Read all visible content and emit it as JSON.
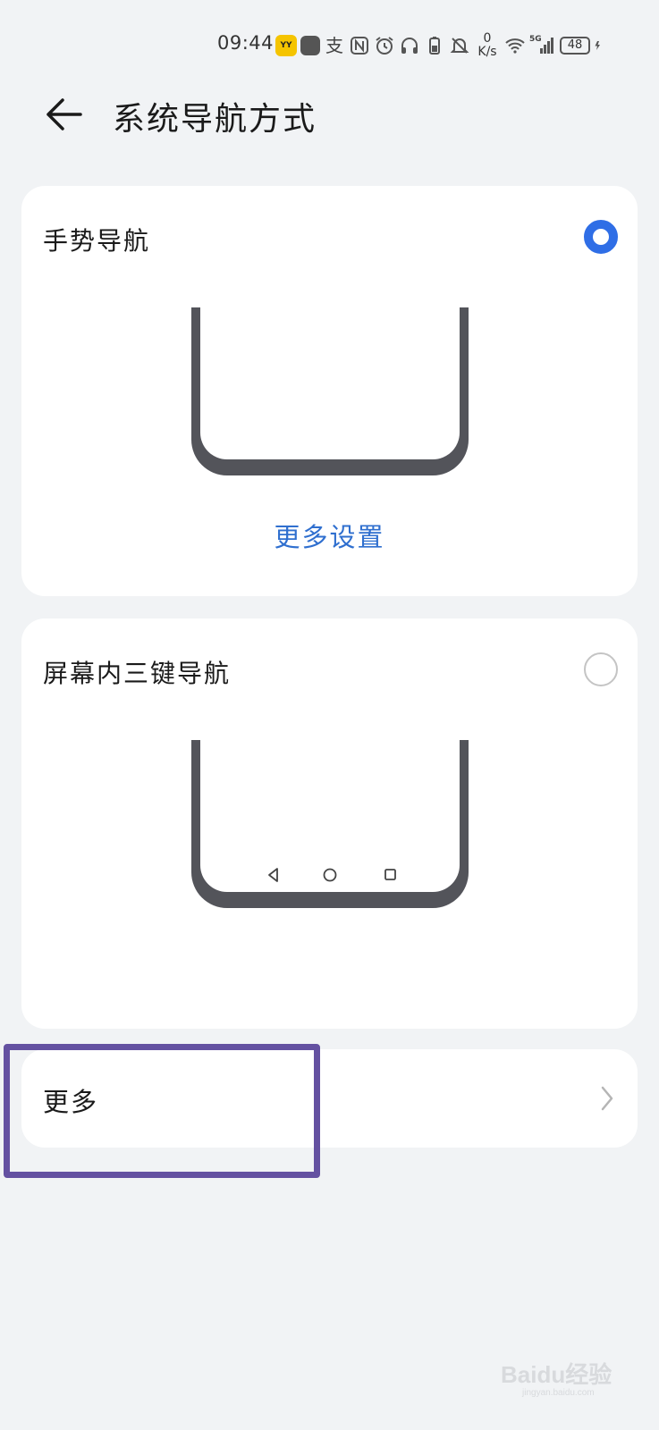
{
  "status_bar": {
    "time": "09:44",
    "app_icon_text": "YY",
    "alipay_glyph": "支",
    "net_speed_value": "0",
    "net_speed_unit": "K/s",
    "network_type": "5G",
    "battery_level": "48",
    "icons": [
      "yy-app-icon",
      "shopping-bag-icon",
      "alipay-icon",
      "nfc-icon",
      "alarm-icon",
      "headphones-icon",
      "battery-small-icon",
      "mute-bell-icon",
      "wifi-icon",
      "signal-icon",
      "battery-icon",
      "charging-icon"
    ]
  },
  "header": {
    "title": "系统导航方式"
  },
  "options": [
    {
      "label": "手势导航",
      "selected": true,
      "link": "更多设置"
    },
    {
      "label": "屏幕内三键导航",
      "selected": false
    }
  ],
  "more": {
    "label": "更多"
  },
  "watermark": {
    "text": "Baidu经验",
    "sub": "jingyan.baidu.com"
  },
  "colors": {
    "accent": "#2f6ee6",
    "link": "#2f6fcf",
    "background": "#f1f3f5",
    "card": "#ffffff",
    "highlight": "#6451a1",
    "phone_frame": "#53545a"
  }
}
